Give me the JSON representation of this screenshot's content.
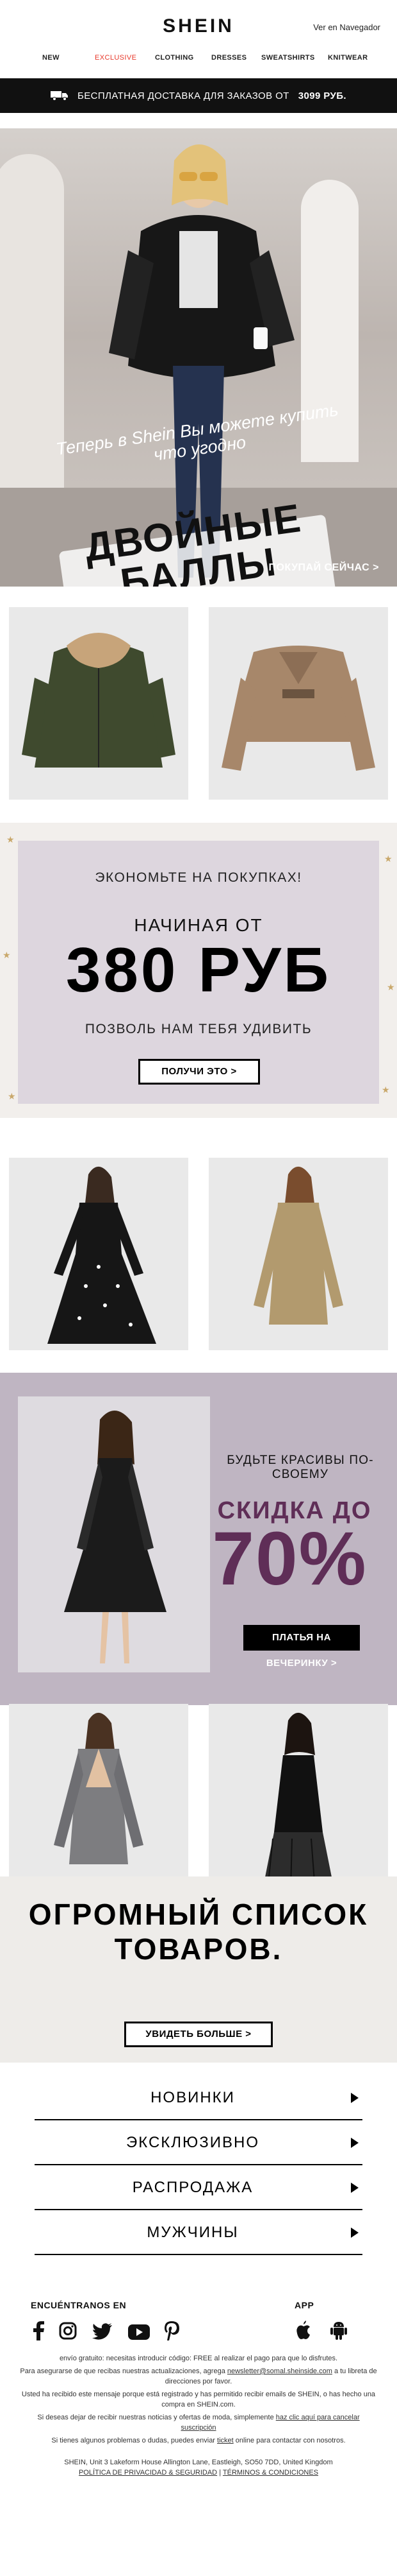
{
  "header": {
    "logo": "SHEIN",
    "browser_link": "Ver en Navegador"
  },
  "nav": [
    {
      "label": "NEW",
      "highlight": false
    },
    {
      "label": "EXCLUSIVE",
      "highlight": true
    },
    {
      "label": "CLOTHING",
      "highlight": false
    },
    {
      "label": "DRESSES",
      "highlight": false
    },
    {
      "label": "SWEATSHIRTS",
      "highlight": false
    },
    {
      "label": "KNITWEAR",
      "highlight": false
    }
  ],
  "shipping": {
    "text": "БЕСПЛАТНАЯ ДОСТАВКА ДЛЯ ЗАКАЗОВ ОТ",
    "amount": "3099 РУБ."
  },
  "hero": {
    "subtitle": "Теперь в Shein Вы можете купить что угодно",
    "title": "ДВОЙНЫЕ БАЛЛЫ",
    "cta": "ПОКУПАЙ СЕЙЧАС >"
  },
  "promo": {
    "line1": "ЭКОНОМЬТЕ НА ПОКУПКАХ!",
    "line2": "НАЧИНАЯ ОТ",
    "line3": "380 РУБ",
    "line4": "ПОЗВОЛЬ НАМ ТЕБЯ УДИВИТЬ",
    "button": "ПОЛУЧИ ЭТО >"
  },
  "sale": {
    "line1": "БУДЬТЕ КРАСИВЫ ПО-СВОЕМУ",
    "line2": "СКИДКА ДО",
    "line3": "70%",
    "button": "ПЛАТЬЯ НА ВЕЧЕРИНКУ >"
  },
  "catalog": {
    "title": "ОГРОМНЫЙ СПИСОК ТОВАРОВ.",
    "button": "УВИДЕТЬ БОЛЬШЕ >"
  },
  "menu": [
    {
      "label": "НОВИНКИ"
    },
    {
      "label": "ЭКСКЛЮЗИВНО"
    },
    {
      "label": "РАСПРОДАЖА"
    },
    {
      "label": "МУЖЧИНЫ"
    }
  ],
  "footer": {
    "social_heading": "ENCUÉNTRANOS EN",
    "app_heading": "APP",
    "social_icons": [
      "facebook-icon",
      "instagram-icon",
      "twitter-icon",
      "youtube-icon",
      "pinterest-icon"
    ],
    "app_icons": [
      "apple-icon",
      "android-icon"
    ],
    "text1": "envío gratuito: necesitas introducir código: FREE al realizar el pago para que lo disfrutes.",
    "text2a": "Para asegurarse de que recibas nuestras actualizaciones, agrega",
    "email": "newsletter@somal.sheinside.com",
    "text2b": "a tu libreta de direcciones por favor.",
    "text3": "Usted ha recibido este mensaje porque está registrado y has permitido recibir emails de SHEIN, o has hecho una compra en SHEIN.com.",
    "text4a": "Si deseas dejar de recibir nuestras noticias y ofertas de moda, simplemente",
    "unsubscribe": "haz clic aquí para cancelar suscripción",
    "text5a": "Si tienes algunos problemas o dudas, puedes enviar",
    "ticket": "ticket",
    "text5b": "online para contactar con nosotros.",
    "address": "SHEIN, Unit 3 Lakeform House Allington Lane, Eastleigh, SO50 7DD, United Kingdom",
    "privacy": "POLÍTICA DE PRIVACIDAD & SEGURIDAD",
    "separator": "|",
    "terms": "TÉRMINOS & CONDICIONES"
  },
  "colors": {
    "accent_red": "#e8392b",
    "sale_purple": "#5f2e57",
    "black": "#000000"
  }
}
